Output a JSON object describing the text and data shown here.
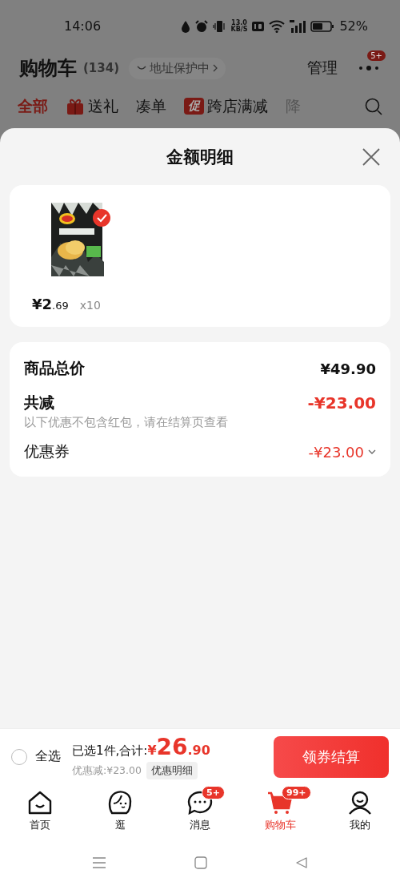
{
  "status_bar": {
    "time": "14:06",
    "speed": "13.0",
    "speed_unit": "KB/S",
    "battery": "52%"
  },
  "header": {
    "title": "购物车",
    "count": "(134)",
    "address_chip": "地址保护中",
    "manage": "管理",
    "more_badge": "5+"
  },
  "category_tabs": [
    {
      "kind": "plain",
      "label": "全部",
      "selected": true
    },
    {
      "kind": "gift",
      "label": "送礼",
      "selected": false
    },
    {
      "kind": "plain",
      "label": "凑单",
      "selected": false
    },
    {
      "kind": "promo",
      "badge": "促",
      "label": "跨店满减",
      "selected": false
    },
    {
      "kind": "faded",
      "label": "降",
      "selected": false
    }
  ],
  "sheet": {
    "title": "金额明细",
    "items": [
      {
        "kind": "picture",
        "selected": true,
        "price_main": "¥2",
        "price_decimal": ".69",
        "quantity": "x10"
      }
    ],
    "summary": [
      {
        "kind": "total",
        "label": "商品总价",
        "amount": "¥49.90"
      },
      {
        "kind": "discount",
        "label": "共减",
        "amount": "-¥23.00",
        "note": "以下优惠不包含红包，请在结算页查看"
      },
      {
        "kind": "coupon",
        "label": "优惠券",
        "amount": "-¥23.00"
      }
    ]
  },
  "checkout_bar": {
    "select_all": {
      "label": "全选",
      "checked": false
    },
    "selected_text": "已选1件,合计:",
    "total_symbol": "¥",
    "total_main": "26",
    "total_decimal": ".90",
    "discount_text": "优惠减:¥23.00",
    "detail_button": "优惠明细",
    "checkout_button": "领券结算"
  },
  "tab_bar": [
    {
      "kind": "home",
      "label": "首页",
      "selected": false
    },
    {
      "kind": "face",
      "label": "逛",
      "selected": false
    },
    {
      "kind": "chat",
      "label": "消息",
      "badge": "5+",
      "selected": false
    },
    {
      "kind": "cart",
      "label": "购物车",
      "badge": "99+",
      "selected": true
    },
    {
      "kind": "person",
      "label": "我的",
      "selected": false
    }
  ]
}
